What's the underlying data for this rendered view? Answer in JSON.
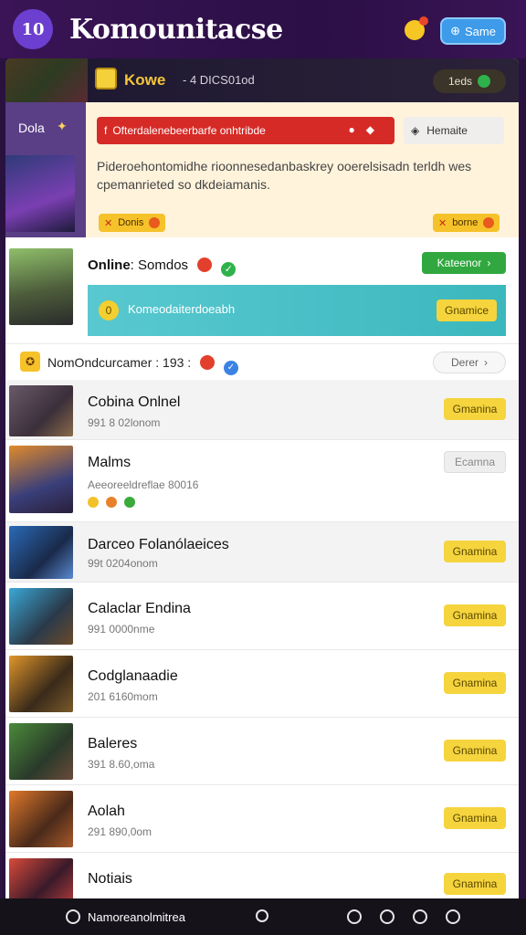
{
  "app": {
    "logo_text": "10",
    "title": "Komounitacse",
    "top_button_label": "Same"
  },
  "banner": {
    "title": "Kowe",
    "subtitle": "- 4 DICS01od",
    "pill_label": "1eds"
  },
  "notice": {
    "side_label": "Dola",
    "red_field_text": "Ofterdalenebeerbarfe onhtribde",
    "gray_field_text": "Hemaite",
    "body_text": "Pideroehontomidhe rioonnesedanbaskrey ooerelsisadn terldh wes cpemanrieted so dkdeiamanis.",
    "chip_left": "Donis",
    "chip_right": "borne"
  },
  "online": {
    "title": "Online",
    "subtitle": ": Somdos",
    "green_button": "Kateenor",
    "teal_coin": "0",
    "teal_text": "Komeodaiterdoeabh",
    "teal_button": "Gnamice"
  },
  "filter": {
    "text": "NomOndcurcamer : 193 :",
    "button": "Derer"
  },
  "list": [
    {
      "title": "Cobina Onlnel",
      "sub": "991 8 02lonom",
      "button": "Gmanina",
      "alt": true,
      "gray_btn": false
    },
    {
      "title": "Malms",
      "sub": "Aeeoreeldreflae 80016",
      "button": "Ecamna",
      "alt": false,
      "gray_btn": true
    },
    {
      "title": "Darceo Folanólaeices",
      "sub": "99t 0204onom",
      "button": "Gnamina",
      "alt": true,
      "gray_btn": false
    },
    {
      "title": "Calaclar Endina",
      "sub": "991 0000nme",
      "button": "Gnamina",
      "alt": false,
      "gray_btn": false
    },
    {
      "title": "Codglanaadie",
      "sub": "201 6160mom",
      "button": "Gnamina",
      "alt": false,
      "gray_btn": false
    },
    {
      "title": "Baleres",
      "sub": "391 8.60,oma",
      "button": "Gnamina",
      "alt": false,
      "gray_btn": false
    },
    {
      "title": "Aolah",
      "sub": "291 890,0om",
      "button": "Gnamina",
      "alt": false,
      "gray_btn": false
    },
    {
      "title": "Notiais",
      "sub": "",
      "button": "Gnamina",
      "alt": false,
      "gray_btn": false
    }
  ],
  "bottom": {
    "label": "Namoreanolmitrea"
  },
  "colors": {
    "accent_purple": "#3a1456",
    "yellow": "#f5d43d",
    "green": "#30a83f",
    "red": "#d62a26",
    "teal": "#3bb8bd"
  }
}
